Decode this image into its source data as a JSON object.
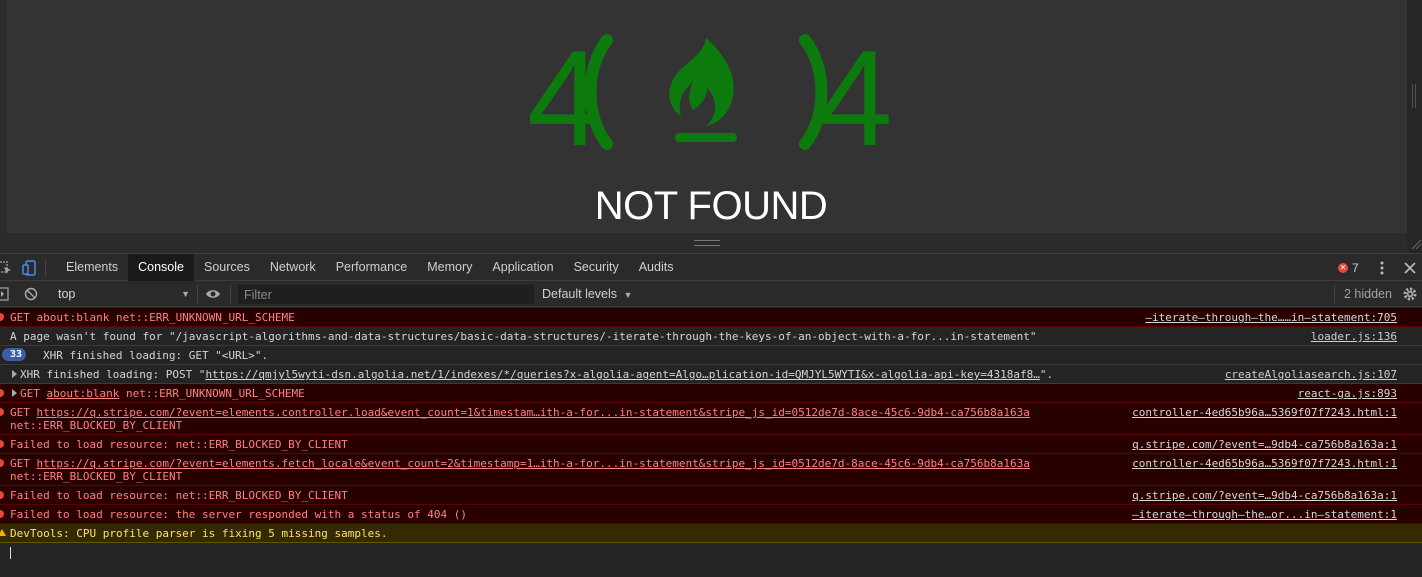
{
  "page": {
    "logo_digit_left": "4",
    "logo_digit_right": "4",
    "heading": "NOT FOUND",
    "logo_color": "#0c7a0c"
  },
  "devtools": {
    "tabs": [
      "Elements",
      "Console",
      "Sources",
      "Network",
      "Performance",
      "Memory",
      "Application",
      "Security",
      "Audits"
    ],
    "active_tab": "Console",
    "error_count": "7",
    "icons": {
      "inspect": "inspect-element-icon",
      "device": "device-toolbar-icon",
      "more": "kebab-menu-icon",
      "close": "close-icon"
    }
  },
  "console_toolbar": {
    "context": "top",
    "filter_placeholder": "Filter",
    "levels": "Default levels",
    "hidden": "2 hidden"
  },
  "messages": [
    {
      "level": "error",
      "text": "GET about:blank net::ERR_UNKNOWN_URL_SCHEME",
      "source": "—iterate—through—the……in—statement:705"
    },
    {
      "level": "info",
      "text": "A page wasn't found for \"/javascript-algorithms-and-data-structures/basic-data-structures/-iterate-through-the-keys-of-an-object-with-a-for...in-statement\"",
      "source": "loader.js:136"
    },
    {
      "level": "info",
      "group_count": "33",
      "text": "XHR finished loading: GET \"<URL>\"."
    },
    {
      "level": "info",
      "text_prefix": "XHR finished loading: POST \"",
      "link": "https://qmjyl5wyti-dsn.algolia.net/1/indexes/*/queries?x-algolia-agent=Algo…plication-id=QMJYL5WYTI&x-algolia-api-key=4318af8…",
      "text_suffix": "\".",
      "source": "createAlgoliasearch.js:107"
    },
    {
      "level": "error",
      "text_prefix": "GET ",
      "link": "about:blank",
      "text_suffix": " net::ERR_UNKNOWN_URL_SCHEME",
      "source": "react-ga.js:893"
    },
    {
      "level": "error",
      "text_prefix": "GET ",
      "link": "https://q.stripe.com/?event=elements.controller.load&event_count=1&timestam…ith-a-for...in-statement&stripe_js_id=0512de7d-8ace-45c6-9db4-ca756b8a163a",
      "line2": "net::ERR_BLOCKED_BY_CLIENT",
      "source": "controller-4ed65b96a…5369f07f7243.html:1"
    },
    {
      "level": "error",
      "text": "Failed to load resource: net::ERR_BLOCKED_BY_CLIENT",
      "source": "q.stripe.com/?event=…9db4-ca756b8a163a:1"
    },
    {
      "level": "error",
      "text_prefix": "GET ",
      "link": "https://q.stripe.com/?event=elements.fetch_locale&event_count=2&timestamp=1…ith-a-for...in-statement&stripe_js_id=0512de7d-8ace-45c6-9db4-ca756b8a163a",
      "line2": "net::ERR_BLOCKED_BY_CLIENT",
      "source": "controller-4ed65b96a…5369f07f7243.html:1"
    },
    {
      "level": "error",
      "text": "Failed to load resource: net::ERR_BLOCKED_BY_CLIENT",
      "source": "q.stripe.com/?event=…9db4-ca756b8a163a:1"
    },
    {
      "level": "error",
      "text": "Failed to load resource: the server responded with a status of 404 ()",
      "source": "—iterate—through—the…or...in—statement:1"
    },
    {
      "level": "warn",
      "text": "DevTools: CPU profile parser is fixing 5 missing samples."
    }
  ]
}
